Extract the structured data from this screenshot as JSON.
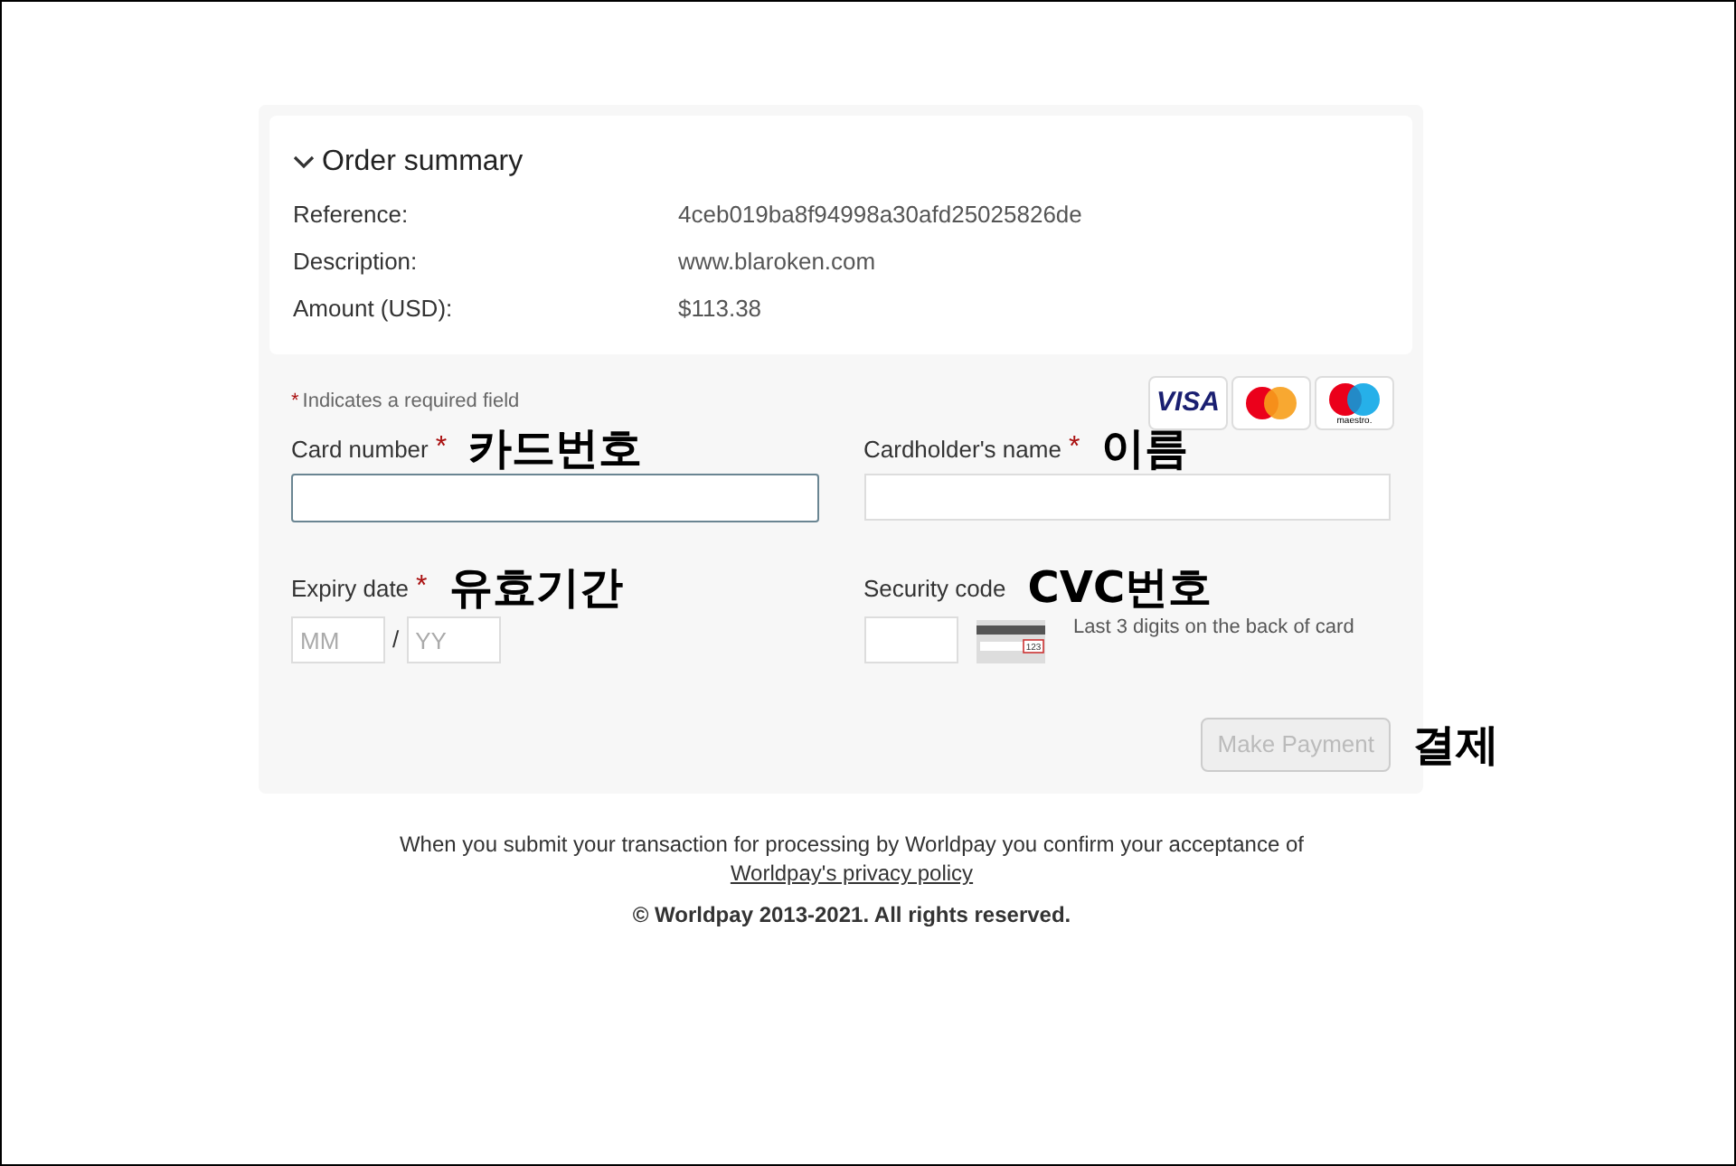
{
  "order_summary": {
    "title": "Order summary",
    "expanded": true,
    "rows": [
      {
        "label": "Reference:",
        "value": "4ceb019ba8f94998a30afd25025826de"
      },
      {
        "label": "Description:",
        "value": "www.blaroken.com"
      },
      {
        "label": "Amount (USD):",
        "value": "$113.38"
      }
    ]
  },
  "form": {
    "required_note": {
      "mark": "*",
      "text": "Indicates a required field"
    },
    "card_logos": [
      {
        "kind": "visa",
        "label": "VISA"
      },
      {
        "kind": "mastercard"
      },
      {
        "kind": "maestro",
        "label": "maestro."
      }
    ],
    "card_number": {
      "label": "Card number",
      "required": true,
      "annotation": "카드번호"
    },
    "cardholder_name": {
      "label": "Cardholder's name",
      "required": true,
      "annotation": "이름"
    },
    "expiry_date": {
      "label": "Expiry date",
      "required": true,
      "annotation": "유효기간",
      "month_placeholder": "MM",
      "separator": "/",
      "year_placeholder": "YY"
    },
    "security_code": {
      "label": "Security code",
      "required": false,
      "annotation": "CVC번호",
      "card_digits": "123",
      "hint": "Last 3 digits on the back of card"
    },
    "submit": {
      "label": "Make Payment",
      "disabled": true,
      "annotation": "결제"
    }
  },
  "footer": {
    "notice": "When you submit your transaction for processing by Worldpay you confirm your acceptance of",
    "link": "Worldpay's privacy policy",
    "copyright": "© Worldpay 2013-2021. All rights reserved."
  }
}
